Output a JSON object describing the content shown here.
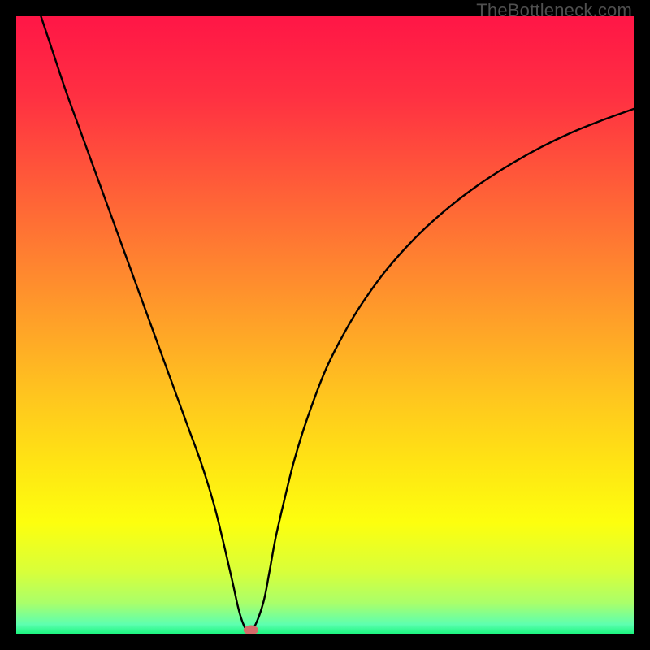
{
  "watermark": "TheBottleneck.com",
  "chart_data": {
    "type": "line",
    "title": "",
    "xlabel": "",
    "ylabel": "",
    "xlim": [
      0,
      100
    ],
    "ylim": [
      0,
      100
    ],
    "grid": false,
    "legend": false,
    "annotations": [],
    "background": {
      "type": "vertical-gradient",
      "stops": [
        {
          "pos": 0.0,
          "color": "#ff1646"
        },
        {
          "pos": 0.13,
          "color": "#ff3042"
        },
        {
          "pos": 0.25,
          "color": "#ff553a"
        },
        {
          "pos": 0.37,
          "color": "#ff7a32"
        },
        {
          "pos": 0.5,
          "color": "#ffa228"
        },
        {
          "pos": 0.62,
          "color": "#ffc71e"
        },
        {
          "pos": 0.72,
          "color": "#ffe314"
        },
        {
          "pos": 0.82,
          "color": "#fdff0e"
        },
        {
          "pos": 0.9,
          "color": "#d8ff3a"
        },
        {
          "pos": 0.95,
          "color": "#aaff6a"
        },
        {
          "pos": 0.985,
          "color": "#5dffb0"
        },
        {
          "pos": 1.0,
          "color": "#1cf57f"
        }
      ]
    },
    "series": [
      {
        "name": "bottleneck-curve",
        "color": "#000000",
        "x": [
          4.0,
          6.0,
          8.0,
          10.0,
          12.0,
          14.0,
          16.0,
          18.0,
          20.0,
          22.0,
          24.0,
          26.0,
          28.0,
          30.0,
          32.0,
          33.5,
          35.0,
          36.0,
          36.8,
          37.5,
          38.5,
          40.0,
          41.0,
          42.0,
          43.5,
          45.0,
          47.0,
          50.0,
          53.0,
          56.0,
          60.0,
          65.0,
          70.0,
          75.0,
          80.0,
          85.0,
          90.0,
          95.0,
          100.0
        ],
        "y": [
          100.0,
          94.0,
          88.0,
          82.5,
          77.0,
          71.5,
          66.0,
          60.5,
          55.0,
          49.5,
          44.0,
          38.5,
          33.0,
          27.5,
          21.0,
          15.0,
          8.5,
          4.0,
          1.5,
          0.5,
          1.0,
          5.0,
          10.0,
          15.5,
          22.0,
          28.0,
          34.5,
          42.5,
          48.5,
          53.5,
          59.0,
          64.5,
          69.0,
          72.8,
          76.0,
          78.8,
          81.2,
          83.2,
          85.0
        ]
      }
    ],
    "marker": {
      "name": "optimal-point",
      "x": 38.0,
      "y": 0.6,
      "color": "#d66a6a",
      "rx": 9,
      "ry": 6
    }
  }
}
